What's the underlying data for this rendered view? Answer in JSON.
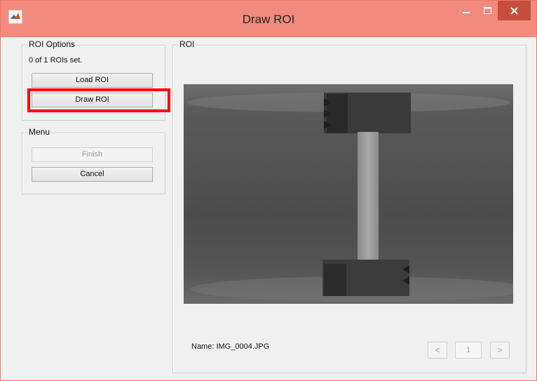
{
  "window": {
    "title": "Draw ROI"
  },
  "roi_options": {
    "label": "ROI Options",
    "status": "0 of 1 ROIs set.",
    "load_label": "Load ROI",
    "draw_label": "Draw ROI"
  },
  "menu": {
    "label": "Menu",
    "finish_label": "Finish",
    "cancel_label": "Cancel"
  },
  "roi_panel": {
    "label": "ROI",
    "name_text": "Name: IMG_0004.JPG",
    "prev_label": "<",
    "page_value": "1",
    "next_label": ">"
  },
  "colors": {
    "titlebar": "#f28b7d",
    "close_button": "#c74d3c",
    "highlight": "#ff0000"
  }
}
